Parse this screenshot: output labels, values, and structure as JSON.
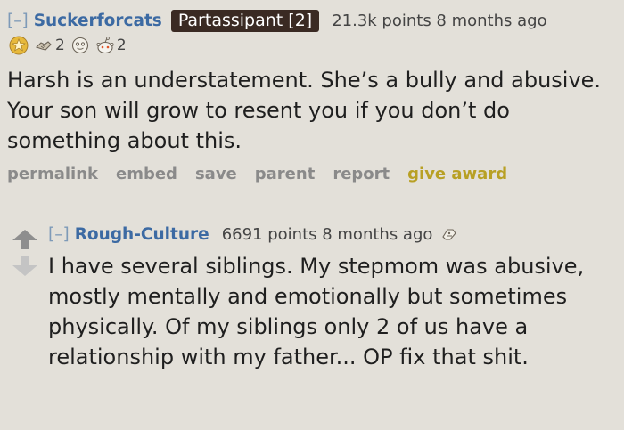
{
  "parent": {
    "expand": "[–]",
    "author": "Suckerforcats",
    "flair": "Partassipant [2]",
    "score": "21.3k points 8 months ago",
    "awards": [
      {
        "icon": "gold-star-award-icon",
        "count": ""
      },
      {
        "icon": "handshake-award-icon",
        "count": "2"
      },
      {
        "icon": "face-award-icon",
        "count": ""
      },
      {
        "icon": "snoo-award-icon",
        "count": "2"
      }
    ],
    "body": "Harsh is an understatement. She’s a bully and abusive. Your son will grow to resent you if you don’t do something about this.",
    "buttons": {
      "permalink": "permalink",
      "embed": "embed",
      "save": "save",
      "parent": "parent",
      "report": "report",
      "give_award": "give award"
    }
  },
  "reply": {
    "expand": "[–]",
    "author": "Rough-Culture",
    "score": "6691 points 8 months ago",
    "award_icon": "wholesome-award-icon",
    "body": "I have several siblings. My stepmom was abusive, mostly mentally and emotionally but sometimes physically. Of my siblings only 2 of us have a relationship with my father... OP fix that shit."
  },
  "colors": {
    "background": "#e3e0d9",
    "author": "#3c6aa3",
    "flair_bg": "#3a2a23",
    "give_award": "#b8a024"
  }
}
